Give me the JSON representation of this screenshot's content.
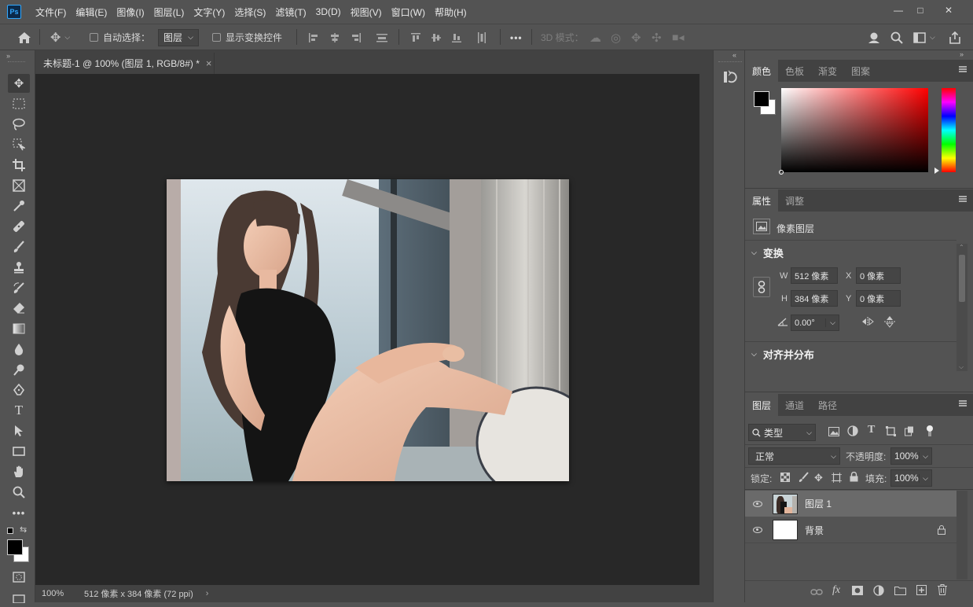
{
  "app": {
    "logo_text": "Ps"
  },
  "menu": [
    "文件(F)",
    "编辑(E)",
    "图像(I)",
    "图层(L)",
    "文字(Y)",
    "选择(S)",
    "滤镜(T)",
    "3D(D)",
    "视图(V)",
    "窗口(W)",
    "帮助(H)"
  ],
  "window_controls": {
    "minimize": "—",
    "maximize": "□",
    "close": "✕"
  },
  "options": {
    "auto_select_label": "自动选择：",
    "auto_select_value": "图层",
    "show_transform_label": "显示变换控件",
    "more": "•••",
    "mode_3d_label": "3D 模式："
  },
  "document": {
    "tab_title": "未标题-1 @ 100% (图层 1, RGB/8#) *",
    "tab_close": "×",
    "zoom": "100%",
    "info": "512 像素 x 384 像素 (72 ppi)",
    "info_arrow": "›"
  },
  "color_panel": {
    "tabs": [
      "颜色",
      "色板",
      "渐变",
      "图案"
    ],
    "active": 0
  },
  "properties_panel": {
    "tabs": [
      "属性",
      "调整"
    ],
    "layer_type": "像素图层",
    "transform_header": "变换",
    "w_label": "W",
    "w_value": "512 像素",
    "h_label": "H",
    "h_value": "384 像素",
    "x_label": "X",
    "x_value": "0 像素",
    "y_label": "Y",
    "y_value": "0 像素",
    "angle_value": "0.00°",
    "align_header": "对齐并分布"
  },
  "layers_panel": {
    "tabs": [
      "图层",
      "通道",
      "路径"
    ],
    "filter_type": "类型",
    "blend_mode": "正常",
    "opacity_label": "不透明度:",
    "opacity_value": "100%",
    "lock_label": "锁定:",
    "fill_label": "填充:",
    "fill_value": "100%",
    "layers": [
      {
        "name": "图层 1",
        "selected": true,
        "locked": false
      },
      {
        "name": "背景",
        "selected": false,
        "locked": true
      }
    ]
  }
}
